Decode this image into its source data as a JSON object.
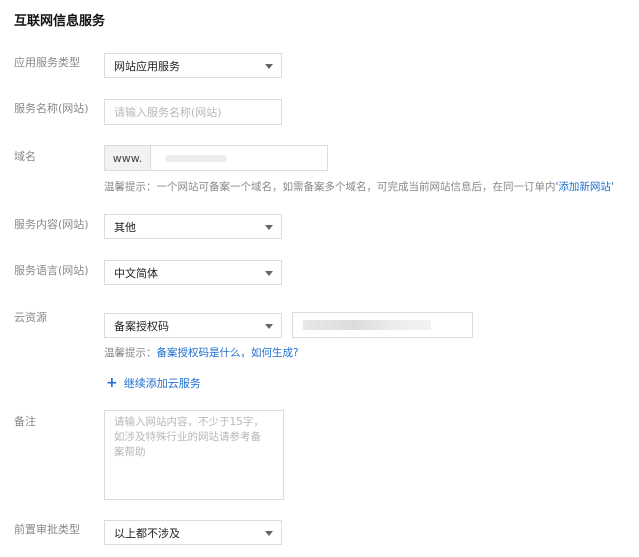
{
  "page": {
    "title": "互联网信息服务"
  },
  "form": {
    "service_type": {
      "label": "应用服务类型",
      "value": "网站应用服务"
    },
    "service_name": {
      "label": "服务名称(网站)",
      "placeholder": "请输入服务名称(网站)"
    },
    "domain": {
      "label": "域名",
      "prefix": "www.",
      "hint_prefix": "温馨提示：一个网站可备案一个域名，如需备案多个域名，可完成当前网站信息后，在同一订单内",
      "hint_link": "'添加新网站'"
    },
    "service_content": {
      "label": "服务内容(网站)",
      "value": "其他"
    },
    "service_language": {
      "label": "服务语言(网站)",
      "value": "中文简体"
    },
    "cloud_resource": {
      "label": "云资源",
      "value": "备案授权码",
      "hint_prefix": "温馨提示：",
      "hint_link": "备案授权码是什么，如何生成?"
    },
    "add_cloud_service": {
      "label": "继续添加云服务"
    },
    "remark": {
      "label": "备注",
      "placeholder": "请输入网站内容，不少于15字，\n如涉及特殊行业的网站请参考备\n案帮助"
    },
    "pre_approval": {
      "label": "前置审批类型",
      "value": "以上都不涉及"
    }
  }
}
